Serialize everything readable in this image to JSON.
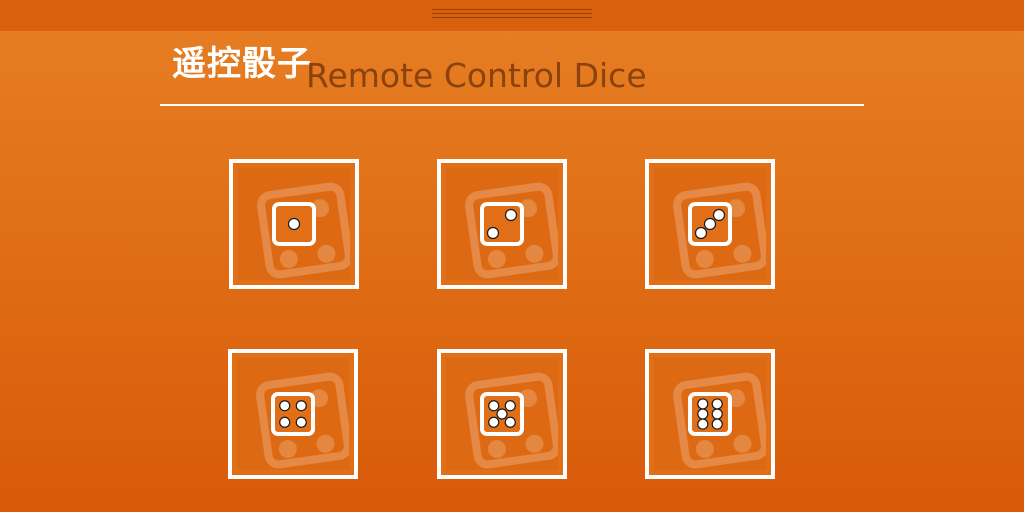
{
  "app": {
    "title_cn": "遥控骰子",
    "title_en": "Remote Control Dice"
  },
  "colors": {
    "background_top": "#e77f24",
    "background_bottom": "#d9590a",
    "title_en": "#8a430c",
    "frame": "#ffffff"
  },
  "dice_buttons": [
    {
      "value": 1,
      "icon": "dice-1-icon"
    },
    {
      "value": 2,
      "icon": "dice-2-icon"
    },
    {
      "value": 3,
      "icon": "dice-3-icon"
    },
    {
      "value": 4,
      "icon": "dice-4-icon"
    },
    {
      "value": 5,
      "icon": "dice-5-icon"
    },
    {
      "value": 6,
      "icon": "dice-6-icon"
    }
  ]
}
